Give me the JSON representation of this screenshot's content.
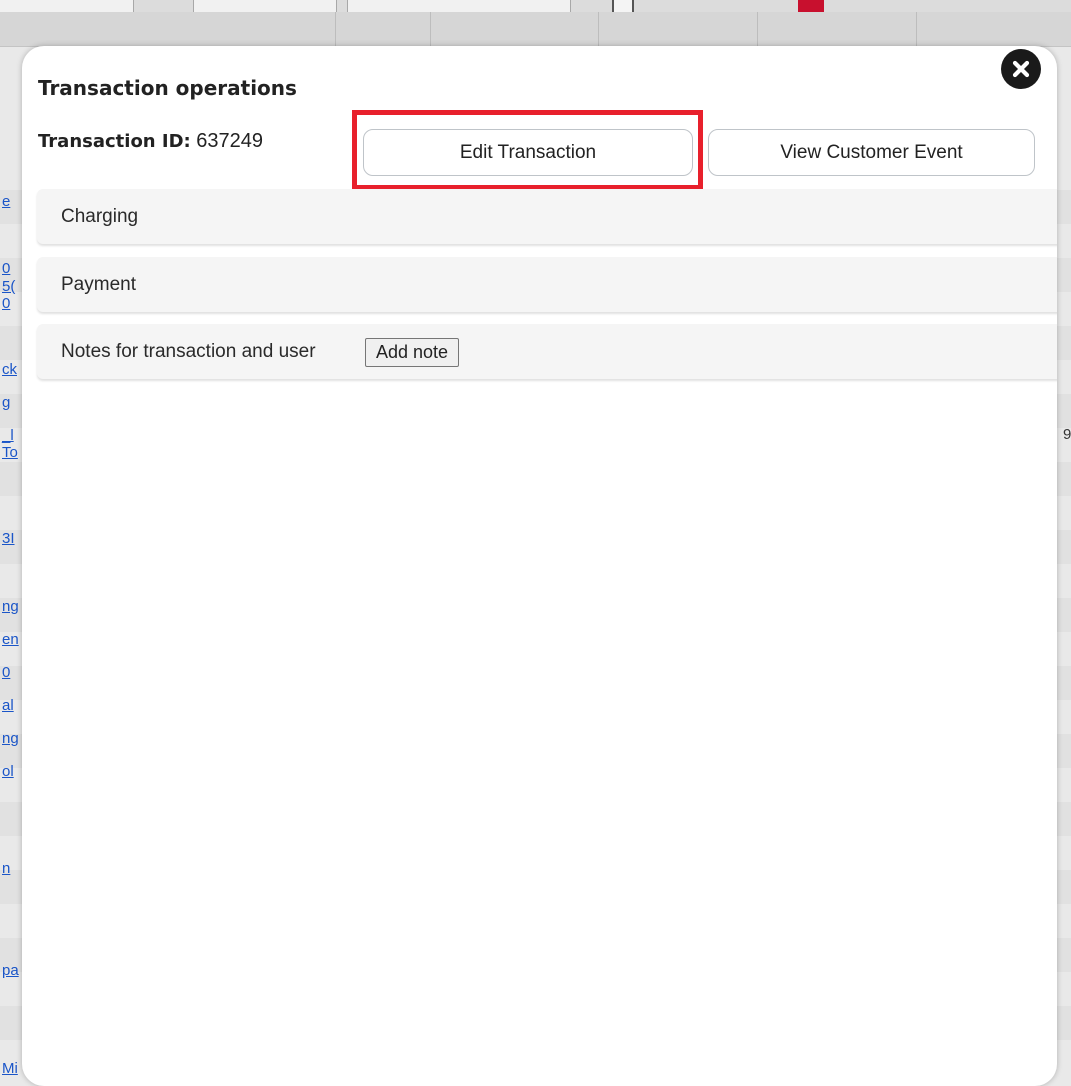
{
  "modal": {
    "title": "Transaction operations",
    "transaction_id_label": "Transaction ID:",
    "transaction_id_value": "637249",
    "buttons": {
      "edit_transaction": "Edit Transaction",
      "view_customer_event": "View Customer Event"
    },
    "sections": [
      {
        "label": "Charging"
      },
      {
        "label": "Payment"
      },
      {
        "label": "Notes for transaction and user",
        "action": "Add note"
      }
    ],
    "close_icon": "close-circle-icon"
  },
  "background": {
    "link_fragments": [
      "e",
      "0",
      "5(",
      "0",
      "ck",
      "g",
      "_l",
      "To",
      "3I",
      "ng",
      "en",
      "0",
      "al",
      "ng",
      "ol",
      "n",
      "pa",
      "Mi"
    ],
    "right_edge_text": "9"
  },
  "colors": {
    "highlight": "#e8202c",
    "link": "#1a55c8"
  }
}
